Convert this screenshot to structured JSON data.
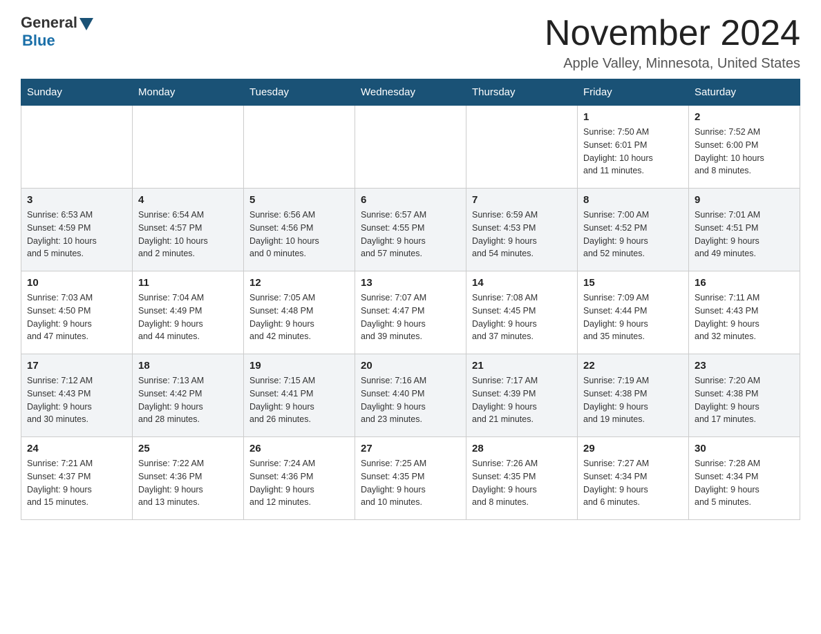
{
  "header": {
    "logo": {
      "general": "General",
      "blue": "Blue"
    },
    "title": "November 2024",
    "location": "Apple Valley, Minnesota, United States"
  },
  "weekdays": [
    "Sunday",
    "Monday",
    "Tuesday",
    "Wednesday",
    "Thursday",
    "Friday",
    "Saturday"
  ],
  "weeks": [
    [
      {
        "day": "",
        "info": ""
      },
      {
        "day": "",
        "info": ""
      },
      {
        "day": "",
        "info": ""
      },
      {
        "day": "",
        "info": ""
      },
      {
        "day": "",
        "info": ""
      },
      {
        "day": "1",
        "info": "Sunrise: 7:50 AM\nSunset: 6:01 PM\nDaylight: 10 hours\nand 11 minutes."
      },
      {
        "day": "2",
        "info": "Sunrise: 7:52 AM\nSunset: 6:00 PM\nDaylight: 10 hours\nand 8 minutes."
      }
    ],
    [
      {
        "day": "3",
        "info": "Sunrise: 6:53 AM\nSunset: 4:59 PM\nDaylight: 10 hours\nand 5 minutes."
      },
      {
        "day": "4",
        "info": "Sunrise: 6:54 AM\nSunset: 4:57 PM\nDaylight: 10 hours\nand 2 minutes."
      },
      {
        "day": "5",
        "info": "Sunrise: 6:56 AM\nSunset: 4:56 PM\nDaylight: 10 hours\nand 0 minutes."
      },
      {
        "day": "6",
        "info": "Sunrise: 6:57 AM\nSunset: 4:55 PM\nDaylight: 9 hours\nand 57 minutes."
      },
      {
        "day": "7",
        "info": "Sunrise: 6:59 AM\nSunset: 4:53 PM\nDaylight: 9 hours\nand 54 minutes."
      },
      {
        "day": "8",
        "info": "Sunrise: 7:00 AM\nSunset: 4:52 PM\nDaylight: 9 hours\nand 52 minutes."
      },
      {
        "day": "9",
        "info": "Sunrise: 7:01 AM\nSunset: 4:51 PM\nDaylight: 9 hours\nand 49 minutes."
      }
    ],
    [
      {
        "day": "10",
        "info": "Sunrise: 7:03 AM\nSunset: 4:50 PM\nDaylight: 9 hours\nand 47 minutes."
      },
      {
        "day": "11",
        "info": "Sunrise: 7:04 AM\nSunset: 4:49 PM\nDaylight: 9 hours\nand 44 minutes."
      },
      {
        "day": "12",
        "info": "Sunrise: 7:05 AM\nSunset: 4:48 PM\nDaylight: 9 hours\nand 42 minutes."
      },
      {
        "day": "13",
        "info": "Sunrise: 7:07 AM\nSunset: 4:47 PM\nDaylight: 9 hours\nand 39 minutes."
      },
      {
        "day": "14",
        "info": "Sunrise: 7:08 AM\nSunset: 4:45 PM\nDaylight: 9 hours\nand 37 minutes."
      },
      {
        "day": "15",
        "info": "Sunrise: 7:09 AM\nSunset: 4:44 PM\nDaylight: 9 hours\nand 35 minutes."
      },
      {
        "day": "16",
        "info": "Sunrise: 7:11 AM\nSunset: 4:43 PM\nDaylight: 9 hours\nand 32 minutes."
      }
    ],
    [
      {
        "day": "17",
        "info": "Sunrise: 7:12 AM\nSunset: 4:43 PM\nDaylight: 9 hours\nand 30 minutes."
      },
      {
        "day": "18",
        "info": "Sunrise: 7:13 AM\nSunset: 4:42 PM\nDaylight: 9 hours\nand 28 minutes."
      },
      {
        "day": "19",
        "info": "Sunrise: 7:15 AM\nSunset: 4:41 PM\nDaylight: 9 hours\nand 26 minutes."
      },
      {
        "day": "20",
        "info": "Sunrise: 7:16 AM\nSunset: 4:40 PM\nDaylight: 9 hours\nand 23 minutes."
      },
      {
        "day": "21",
        "info": "Sunrise: 7:17 AM\nSunset: 4:39 PM\nDaylight: 9 hours\nand 21 minutes."
      },
      {
        "day": "22",
        "info": "Sunrise: 7:19 AM\nSunset: 4:38 PM\nDaylight: 9 hours\nand 19 minutes."
      },
      {
        "day": "23",
        "info": "Sunrise: 7:20 AM\nSunset: 4:38 PM\nDaylight: 9 hours\nand 17 minutes."
      }
    ],
    [
      {
        "day": "24",
        "info": "Sunrise: 7:21 AM\nSunset: 4:37 PM\nDaylight: 9 hours\nand 15 minutes."
      },
      {
        "day": "25",
        "info": "Sunrise: 7:22 AM\nSunset: 4:36 PM\nDaylight: 9 hours\nand 13 minutes."
      },
      {
        "day": "26",
        "info": "Sunrise: 7:24 AM\nSunset: 4:36 PM\nDaylight: 9 hours\nand 12 minutes."
      },
      {
        "day": "27",
        "info": "Sunrise: 7:25 AM\nSunset: 4:35 PM\nDaylight: 9 hours\nand 10 minutes."
      },
      {
        "day": "28",
        "info": "Sunrise: 7:26 AM\nSunset: 4:35 PM\nDaylight: 9 hours\nand 8 minutes."
      },
      {
        "day": "29",
        "info": "Sunrise: 7:27 AM\nSunset: 4:34 PM\nDaylight: 9 hours\nand 6 minutes."
      },
      {
        "day": "30",
        "info": "Sunrise: 7:28 AM\nSunset: 4:34 PM\nDaylight: 9 hours\nand 5 minutes."
      }
    ]
  ]
}
